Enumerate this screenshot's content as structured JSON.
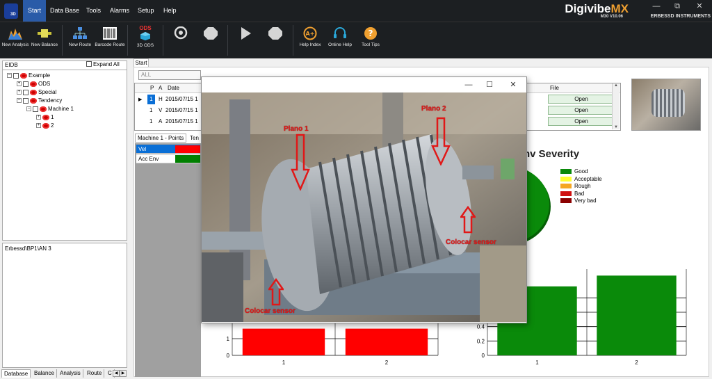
{
  "app": {
    "logo_text": "3D",
    "brand_prefix": "Digivibe",
    "brand_suffix": "MX",
    "version": "M30 V10.06",
    "company": "ERBESSD INSTRUMENTS"
  },
  "menu": [
    "Start",
    "Data Base",
    "Tools",
    "Alarms",
    "Setup",
    "Help"
  ],
  "ribbon": {
    "new_analysis": "New Analysis",
    "new_balance": "New Balance",
    "new_route": "New Route",
    "barcode_route": "Barcode Route",
    "ods_label": "ODS",
    "ods_3d": "3D ODS",
    "help_index": "Help Index",
    "online_help": "Online Help",
    "tool_tips": "Tool Tips"
  },
  "left": {
    "eidb": "EIDB",
    "expand_all": "Expand All",
    "tree": {
      "example": "Example",
      "ods": "ODS",
      "special": "Special",
      "tendency": "Tendency",
      "machine": "Machine 1",
      "child1": "1",
      "child2": "2"
    },
    "path": "Erbessd\\BP1\\AN 3",
    "tabs": [
      "Database",
      "Balance",
      "Analysis",
      "Route",
      "C"
    ]
  },
  "main": {
    "tab": "Start",
    "filter": "ALL",
    "grid": {
      "headers": [
        "P",
        "A",
        "Date",
        "File"
      ],
      "rows": [
        {
          "p": "1",
          "a": "H",
          "date": "2015/07/15 1",
          "file": "Open"
        },
        {
          "p": "1",
          "a": "V",
          "date": "2015/07/15 1",
          "file": "Open"
        },
        {
          "p": "1",
          "a": "A",
          "date": "2015/07/15 1",
          "file": "Open"
        }
      ]
    },
    "points_tabs": [
      "Machine 1 - Points",
      "Ten"
    ],
    "points": [
      {
        "name": "Vel",
        "color": "#ff0000"
      },
      {
        "name": "Acc Env",
        "color": "#008000"
      }
    ]
  },
  "chart_data": [
    {
      "type": "pie",
      "title": "nv Severity",
      "legend": [
        "Good",
        "Acceptable",
        "Rough",
        "Bad",
        "Very bad"
      ],
      "legend_colors": [
        "#0a8a0a",
        "#ffff33",
        "#f5a623",
        "#d01010",
        "#8b0000"
      ],
      "legend_position": "right"
    },
    {
      "type": "bar",
      "categories": [
        "1",
        "2"
      ],
      "values": [
        1.6,
        1.6
      ],
      "colors": [
        "#ff0000",
        "#ff0000"
      ],
      "yticks": [
        "0",
        "1"
      ],
      "ylim": [
        0,
        2
      ]
    },
    {
      "type": "bar",
      "categories": [
        "1",
        "2"
      ],
      "values": [
        0.96,
        1.11
      ],
      "colors": [
        "#0a8a0a",
        "#0a8a0a"
      ],
      "yticks": [
        "0",
        "0.2",
        "0.4",
        "0.6",
        "0.8"
      ],
      "ylim": [
        0,
        1.2
      ]
    }
  ],
  "photo_window": {
    "annotations": [
      "Plano 1",
      "Plano 2",
      "Colocar sensor",
      "Colocar sensor"
    ]
  }
}
